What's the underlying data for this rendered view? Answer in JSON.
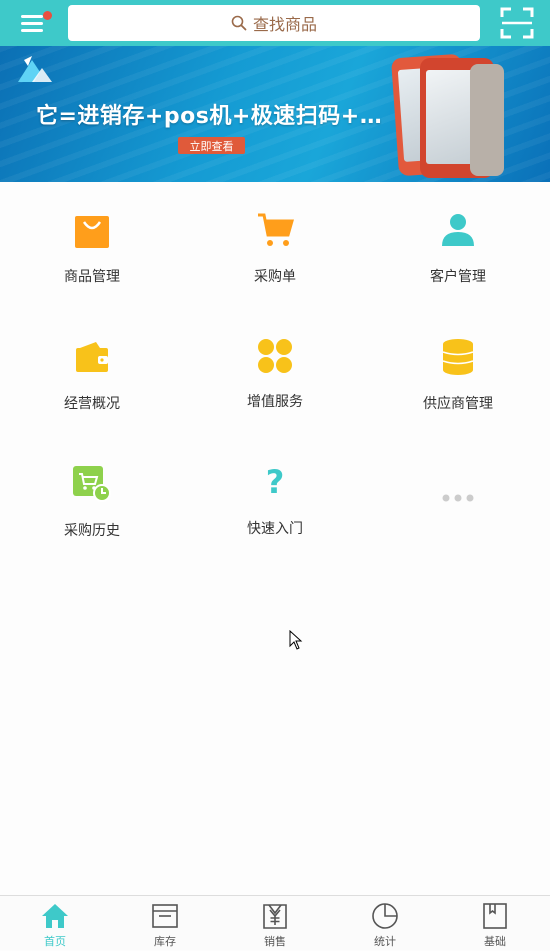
{
  "header": {
    "search_placeholder": "查找商品",
    "icons": {
      "menu": "menu-icon",
      "search": "search-icon",
      "scan": "scan-icon"
    },
    "notification_dot_color": "#e8503f",
    "accent_color": "#3ec9c9"
  },
  "banner": {
    "headline": "它=进销存+pos机+极速扫码+…",
    "cta": "立即查看"
  },
  "grid": {
    "items": [
      {
        "label": "商品管理",
        "icon": "shopping-bag-icon"
      },
      {
        "label": "采购单",
        "icon": "cart-icon"
      },
      {
        "label": "客户管理",
        "icon": "user-icon"
      },
      {
        "label": "经营概况",
        "icon": "wallet-icon"
      },
      {
        "label": "增值服务",
        "icon": "clover-icon"
      },
      {
        "label": "供应商管理",
        "icon": "coins-icon"
      },
      {
        "label": "采购历史",
        "icon": "cart-history-icon"
      },
      {
        "label": "快速入门",
        "icon": "question-icon"
      }
    ],
    "more_icon": "more-dots-icon"
  },
  "tabbar": {
    "tabs": [
      {
        "label": "首页",
        "icon": "home-icon",
        "active": true
      },
      {
        "label": "库存",
        "icon": "inventory-box-icon",
        "active": false
      },
      {
        "label": "销售",
        "icon": "sales-yen-icon",
        "active": false
      },
      {
        "label": "统计",
        "icon": "pie-chart-icon",
        "active": false
      },
      {
        "label": "基础",
        "icon": "book-icon",
        "active": false
      }
    ]
  }
}
